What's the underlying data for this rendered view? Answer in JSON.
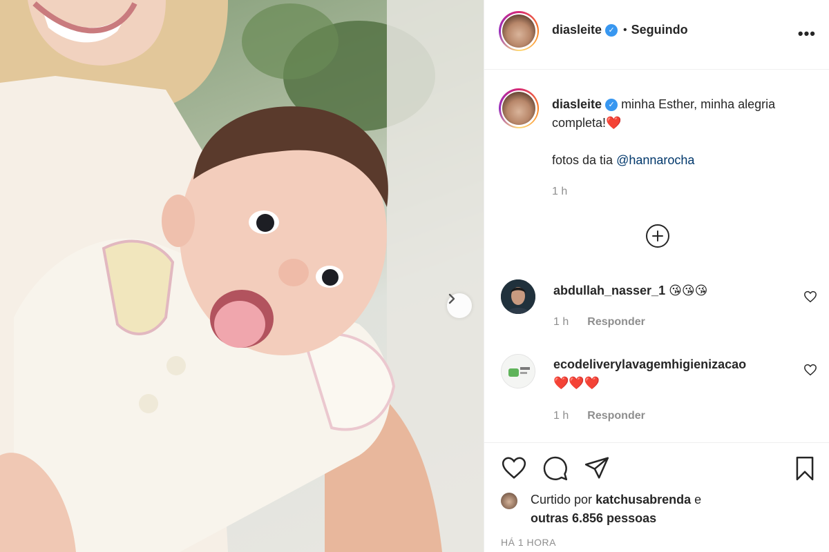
{
  "post": {
    "username": "diasleite",
    "verified_icon": "verified-badge-icon",
    "separator": "•",
    "follow_status": "Seguindo",
    "more_options": "•••"
  },
  "caption": {
    "username": "diasleite",
    "text": "minha Esther, minha alegria completa!",
    "emoji": "❤️",
    "credit_prefix": "fotos da tia",
    "mention": "@hannarocha",
    "time": "1 h"
  },
  "comments": [
    {
      "username": "abdullah_nasser_1",
      "text": "😘😘😘",
      "time": "1 h",
      "reply_label": "Responder"
    },
    {
      "username": "ecodeliverylavagemhigienizacao",
      "text": "❤️❤️❤️",
      "time": "1 h",
      "reply_label": "Responder"
    }
  ],
  "likes": {
    "prefix": "Curtido por",
    "user": "katchusabrenda",
    "connector": "e",
    "others": "outras 6.856 pessoas"
  },
  "timestamp": "HÁ 1 HORA",
  "colors": {
    "verified": "#3897f0",
    "mention": "#00376b",
    "muted": "#8e8e8e",
    "text": "#262626",
    "heart_red": "#e0245e"
  }
}
